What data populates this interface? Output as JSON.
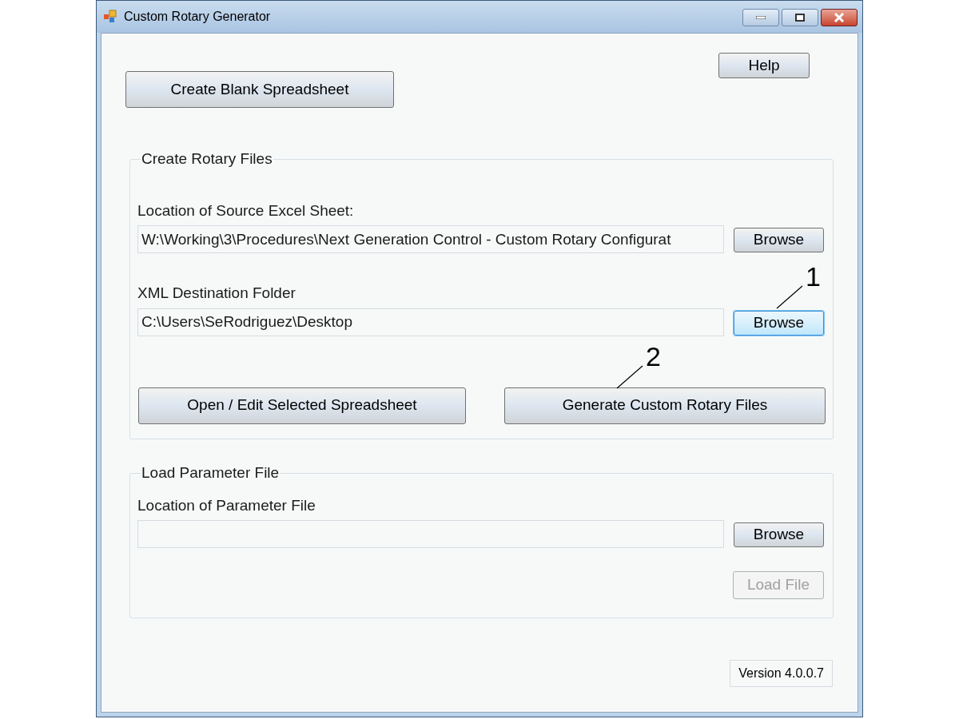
{
  "window": {
    "title": "Custom Rotary Generator"
  },
  "help_button": {
    "label": "Help",
    "disabled": false,
    "focused": false
  },
  "create_blank_button": {
    "label": "Create Blank Spreadsheet",
    "disabled": false,
    "focused": false
  },
  "groups": [
    {
      "title": "Create Rotary Files",
      "fields": [
        {
          "label": "Location of Source Excel Sheet:",
          "value": "W:\\Working\\3\\Procedures\\Next Generation Control - Custom Rotary Configurat",
          "browse": {
            "label": "Browse",
            "disabled": false,
            "focused": false
          }
        },
        {
          "label": "XML Destination Folder",
          "value": "C:\\Users\\SeRodriguez\\Desktop",
          "browse": {
            "label": "Browse",
            "disabled": false,
            "focused": true
          }
        }
      ],
      "actions": [
        {
          "label": "Open / Edit Selected Spreadsheet",
          "disabled": false,
          "focused": false
        },
        {
          "label": "Generate Custom Rotary Files",
          "disabled": false,
          "focused": false
        }
      ]
    },
    {
      "title": "Load Parameter File",
      "fields": [
        {
          "label": "Location of Parameter File",
          "browse": {
            "label": "Browse",
            "disabled": false,
            "focused": false
          }
        }
      ],
      "actions": [
        {
          "label": "Load File",
          "disabled": true,
          "focused": false
        }
      ]
    }
  ],
  "version": "Version 4.0.0.7",
  "callouts": [
    {
      "label": "1"
    },
    {
      "label": "2"
    }
  ]
}
